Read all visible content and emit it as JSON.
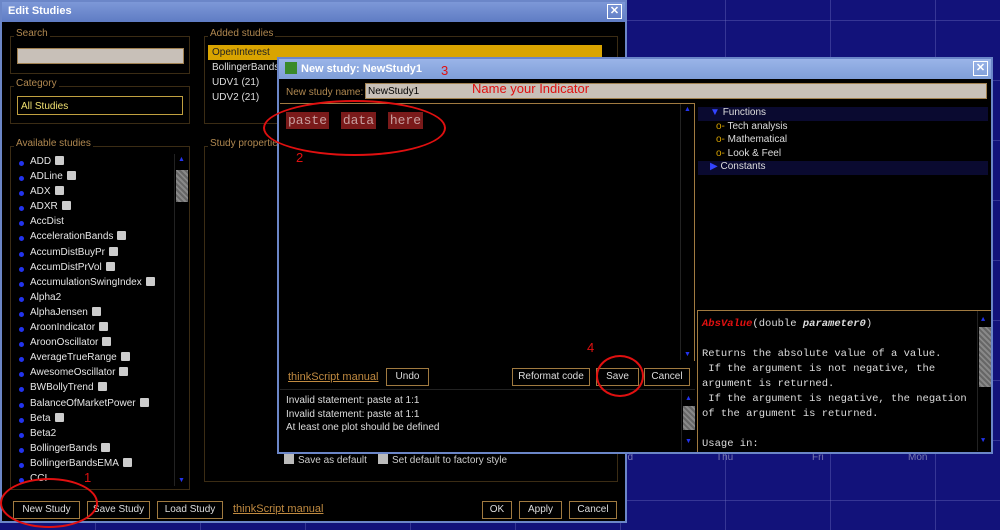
{
  "background": {
    "axis_labels": [
      "ed",
      "Thu",
      "Fri",
      "Mon"
    ]
  },
  "edit_studies": {
    "title": "Edit Studies",
    "search_label": "Search",
    "search_value": "",
    "category_label": "Category",
    "category_value": "All Studies",
    "available_label": "Available studies",
    "available": [
      "ADD",
      "ADLine",
      "ADX",
      "ADXR",
      "AccDist",
      "AccelerationBands",
      "AccumDistBuyPr",
      "AccumDistPrVol",
      "AccumulationSwingIndex",
      "Alpha2",
      "AlphaJensen",
      "AroonIndicator",
      "AroonOscillator",
      "AverageTrueRange",
      "AwesomeOscillator",
      "BWBollyTrend",
      "BalanceOfMarketPower",
      "Beta",
      "Beta2",
      "BollingerBands",
      "BollingerBandsEMA",
      "CCI"
    ],
    "available_icons": [
      1,
      1,
      1,
      1,
      0,
      1,
      1,
      1,
      1,
      0,
      1,
      1,
      1,
      1,
      1,
      1,
      1,
      1,
      0,
      1,
      1,
      0
    ],
    "added_label": "Added studies",
    "added": [
      "OpenInterest",
      "BollingerBands",
      "UDV1 (21)",
      "UDV2 (21)"
    ],
    "properties_label": "Study properties",
    "save_default": "Save as default",
    "factory_default": "Set default to factory style",
    "buttons": {
      "new": "New Study",
      "save": "Save Study",
      "load": "Load Study",
      "manual": "thinkScript manual",
      "ok": "OK",
      "apply": "Apply",
      "cancel": "Cancel"
    }
  },
  "new_study": {
    "title": "New study: NewStudy1",
    "name_label": "New study name:",
    "name_value": "NewStudy1",
    "code": [
      "paste",
      "data",
      "here"
    ],
    "tree": [
      "Functions",
      "Tech analysis",
      "Mathematical",
      "Look & Feel",
      "Constants"
    ],
    "help": {
      "func": "AbsValue",
      "sig_pre": "(double ",
      "param": "parameter0",
      "sig_post": ")",
      "lines": [
        "Returns the absolute value of a value.",
        " If the argument is not negative, the",
        "argument is returned.",
        " If the argument is negative, the negation",
        "of the argument is returned.",
        "",
        "Usage in:"
      ]
    },
    "buttons": {
      "manual": "thinkScript manual",
      "undo": "Undo",
      "reformat": "Reformat code",
      "save": "Save",
      "cancel": "Cancel"
    },
    "messages": [
      "Invalid statement: paste at 1:1",
      "Invalid statement: paste at 1:1",
      "At least one plot should be defined"
    ]
  },
  "annotations": {
    "n1": "1",
    "n2": "2",
    "n3": "3",
    "n4": "4",
    "name_hint": "Name your Indicator"
  },
  "colors": {
    "annotation": "#e01010",
    "highlight": "#d9a400",
    "accent": "#b08850"
  }
}
